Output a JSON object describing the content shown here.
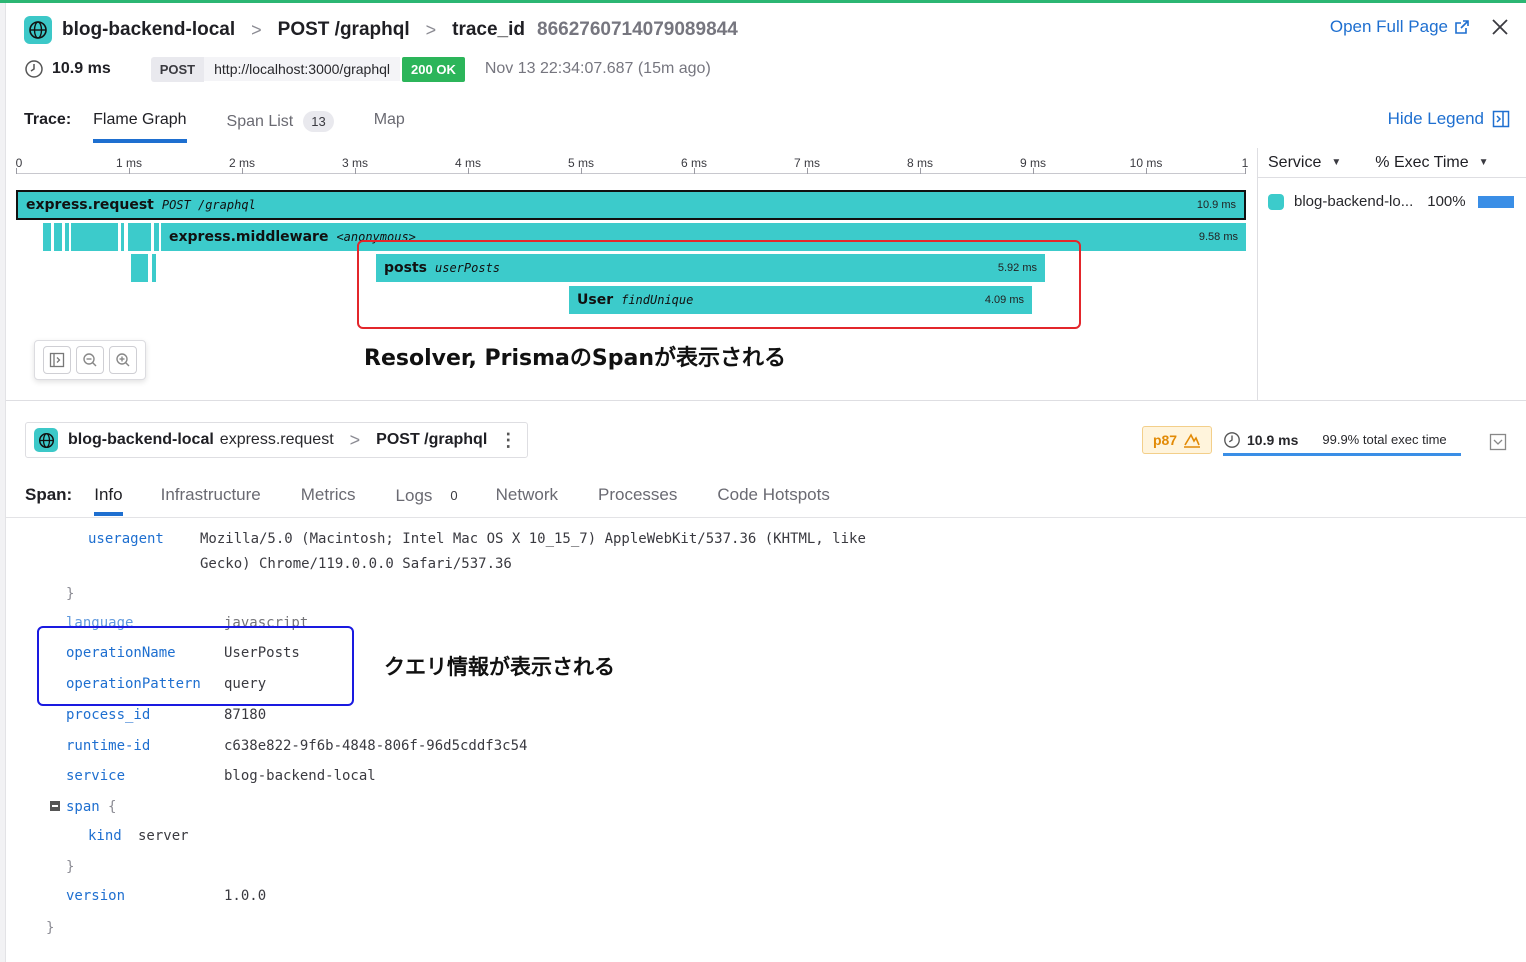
{
  "header": {
    "service": "blog-backend-local",
    "sep1": ">",
    "resource": "POST /graphql",
    "sep2": ">",
    "trace_label": "trace_id",
    "trace_id": "8662760714079089844",
    "open_full_page": "Open Full Page",
    "duration": "10.9 ms",
    "method": "POST",
    "url": "http://localhost:3000/graphql",
    "status": "200 OK",
    "timestamp": "Nov 13 22:34:07.687 (15m ago)"
  },
  "trace_tabs": {
    "label": "Trace:",
    "flame_graph": "Flame Graph",
    "span_list": "Span List",
    "span_count": "13",
    "map": "Map",
    "hide_legend": "Hide Legend"
  },
  "ruler": {
    "ticks": [
      "0",
      "1 ms",
      "2 ms",
      "3 ms",
      "4 ms",
      "5 ms",
      "6 ms",
      "7 ms",
      "8 ms",
      "9 ms",
      "10 ms",
      "1"
    ]
  },
  "spans": [
    {
      "name": "express.request",
      "resource": "POST /graphql",
      "duration": "10.9 ms"
    },
    {
      "name": "express.middleware",
      "resource": "<anonymous>",
      "duration": "9.58 ms"
    },
    {
      "name": "posts",
      "resource": "userPosts",
      "duration": "5.92 ms"
    },
    {
      "name": "User",
      "resource": "findUnique",
      "duration": "4.09 ms"
    }
  ],
  "annotation_flame": "Resolver, PrismaのSpanが表示される",
  "legend": {
    "col_service": "Service",
    "col_exec": "% Exec Time",
    "row_service": "blog-backend-lo...",
    "row_pct": "100%",
    "color": "#3ccbcb"
  },
  "span_header": {
    "service": "blog-backend-local",
    "operation": "express.request",
    "sep": ">",
    "resource": "POST /graphql",
    "percentile": "p87",
    "duration": "10.9 ms",
    "exec_time": "99.9% total exec time"
  },
  "span_tabs": {
    "label": "Span:",
    "info": "Info",
    "infrastructure": "Infrastructure",
    "metrics": "Metrics",
    "logs": "Logs",
    "logs_count": "0",
    "network": "Network",
    "processes": "Processes",
    "code_hotspots": "Code Hotspots"
  },
  "info": {
    "useragent_key": "useragent",
    "useragent_val1": "Mozilla/5.0 (Macintosh; Intel Mac OS X 10_15_7) AppleWebKit/537.36 (KHTML, like",
    "useragent_val2": "Gecko) Chrome/119.0.0.0 Safari/537.36",
    "close_brace": "}",
    "language_key": "language",
    "language_val": "javascript",
    "opname_key": "operationName",
    "opname_val": "UserPosts",
    "oppattern_key": "operationPattern",
    "oppattern_val": "query",
    "pid_key": "process_id",
    "pid_val": "87180",
    "runtime_key": "runtime-id",
    "runtime_val": "c638e822-9f6b-4848-806f-96d5cddf3c54",
    "service_key": "service",
    "service_val": "blog-backend-local",
    "span_key": "span",
    "open_brace": "{",
    "kind_key": "kind",
    "kind_val": "server",
    "version_key": "version",
    "version_val": "1.0.0"
  },
  "annotation_info": "クエリ情報が表示される"
}
